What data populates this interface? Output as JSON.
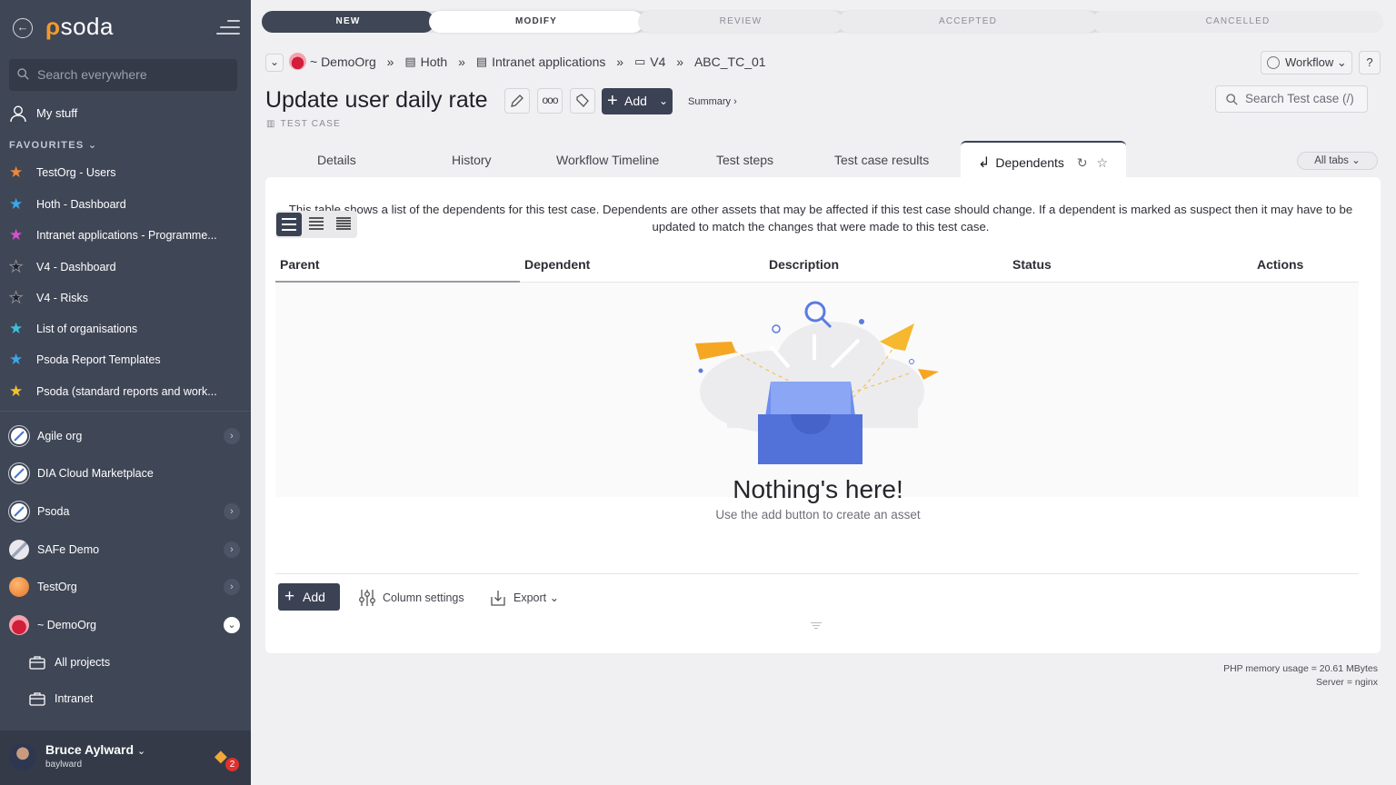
{
  "sidebar": {
    "logo": "psoda",
    "search_placeholder": "Search everywhere",
    "my_stuff": "My stuff",
    "favourites_heading": "FAVOURITES",
    "favourites": [
      {
        "label": "TestOrg - Users",
        "color": "#f0883a"
      },
      {
        "label": "Hoth - Dashboard",
        "color": "#3aa8e8"
      },
      {
        "label": "Intranet applications - Programme...",
        "color": "#d94fcb"
      },
      {
        "label": "V4 - Dashboard",
        "color": "#1f1f24"
      },
      {
        "label": "V4 - Risks",
        "color": "#1f1f24"
      },
      {
        "label": "List of organisations",
        "color": "#3ec0d8"
      },
      {
        "label": "Psoda Report Templates",
        "color": "#3aa8e8"
      },
      {
        "label": "Psoda (standard reports and work...",
        "color": "#f2c232"
      }
    ],
    "orgs": [
      {
        "label": "Agile org",
        "has_chevron": true
      },
      {
        "label": "DIA Cloud Marketplace",
        "has_chevron": false
      },
      {
        "label": "Psoda",
        "has_chevron": true
      },
      {
        "label": "SAFe Demo",
        "has_chevron": true
      },
      {
        "label": "TestOrg",
        "has_chevron": true
      },
      {
        "label": "~ DemoOrg",
        "has_chevron": true
      }
    ],
    "sub_items": [
      "All projects",
      "Intranet"
    ],
    "user": {
      "name": "Bruce Aylward",
      "login": "baylward",
      "notifications": "2"
    }
  },
  "workflow_steps": [
    "NEW",
    "MODIFY",
    "REVIEW",
    "ACCEPTED",
    "CANCELLED"
  ],
  "breadcrumb": [
    "~ DemoOrg",
    "Hoth",
    "Intranet applications",
    "V4",
    "ABC_TC_01"
  ],
  "workflow_button": "Workflow",
  "help_button": "?",
  "page": {
    "title": "Update user daily rate",
    "type": "TEST CASE",
    "add_label": "Add",
    "summary_label": "Summary ›",
    "search_placeholder": "Search Test case (/)"
  },
  "tabs": [
    "Details",
    "History",
    "Workflow Timeline",
    "Test steps",
    "Test case results",
    "Dependents"
  ],
  "active_tab": "Dependents",
  "all_tabs_label": "All tabs",
  "dependents": {
    "description": "This table shows a list of the dependents for this test case. Dependents are other assets that may be affected if this test case should change. If a dependent is marked as suspect then it may have to be updated to match the changes that were made to this test case.",
    "columns": [
      "Parent",
      "Dependent",
      "Description",
      "Status",
      "Actions"
    ],
    "empty_title": "Nothing's here!",
    "empty_subtitle": "Use the add button to create an asset",
    "add_label": "Add",
    "column_settings_label": "Column settings",
    "export_label": "Export"
  },
  "footer": {
    "memory": "PHP memory usage = 20.61 MBytes",
    "server": "Server = nginx"
  },
  "colors": {
    "sidebar": "#3f4656",
    "accent": "#3b4254",
    "brand_orange": "#f29a2e",
    "illustration_blue": "#5b7be0"
  }
}
